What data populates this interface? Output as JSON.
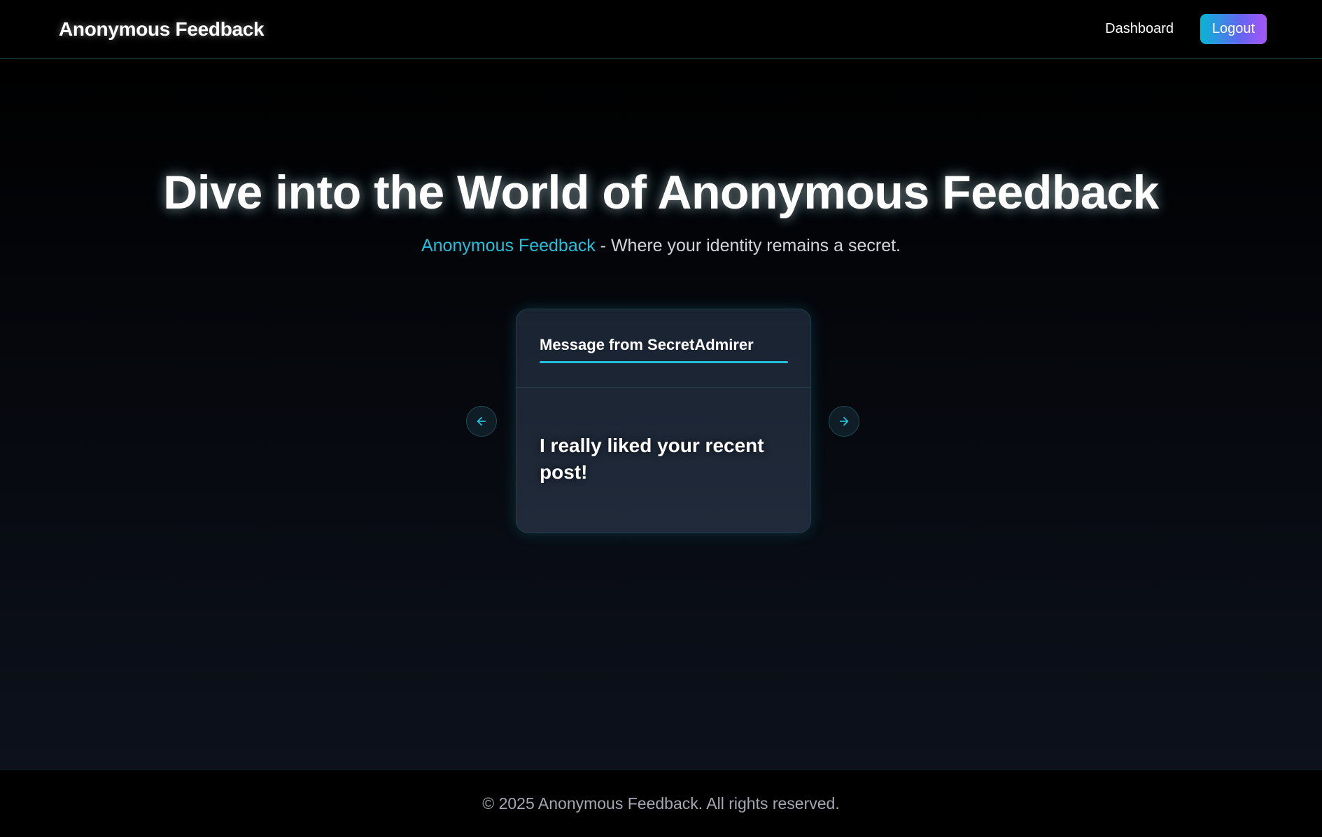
{
  "navbar": {
    "brand": "Anonymous Feedback",
    "links": {
      "dashboard": "Dashboard"
    },
    "logout_label": "Logout"
  },
  "hero": {
    "title": "Dive into the World of Anonymous Feedback",
    "subtitle_accent": "Anonymous Feedback",
    "subtitle_rest": " - Where your identity remains a secret."
  },
  "carousel": {
    "messages": [
      {
        "title": "Message from SecretAdmirer",
        "content": "I really liked your recent post!"
      }
    ],
    "icons": {
      "prev": "arrow-left-icon",
      "next": "arrow-right-icon"
    }
  },
  "footer": {
    "copyright": "© 2025 Anonymous Feedback. All rights reserved."
  },
  "colors": {
    "accent": "#22c0dc",
    "logout_gradient_start": "#06b6d4",
    "logout_gradient_end": "#a855f7",
    "background": "#000000",
    "card_background": "#1e2736"
  }
}
